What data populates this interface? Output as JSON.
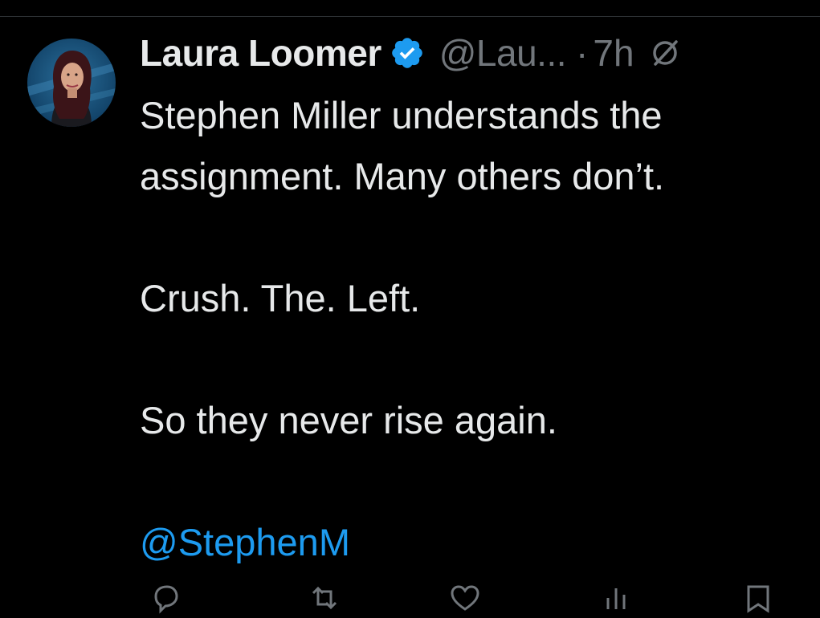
{
  "tweet": {
    "author": {
      "display_name": "Laura Loomer",
      "handle": "@Lau...",
      "verified": true,
      "avatar": "profile-photo"
    },
    "separator": "·",
    "timestamp": "7h",
    "text": {
      "line1": "Stephen Miller understands the",
      "line2": "assignment. Many others don’t.",
      "line3": "Crush. The. Left.",
      "line4": "So they never rise again.",
      "mention": "@StephenM"
    }
  },
  "icons": {
    "verified": "verified-badge-icon",
    "grok": "grok-icon",
    "reply": "reply-icon",
    "retweet": "retweet-icon",
    "like": "like-icon",
    "views": "views-icon",
    "bookmark": "bookmark-icon"
  },
  "colors": {
    "background": "#000000",
    "text": "#e7e9ea",
    "muted": "#71767b",
    "accent": "#1d9bf0",
    "divider": "#2f3336"
  }
}
